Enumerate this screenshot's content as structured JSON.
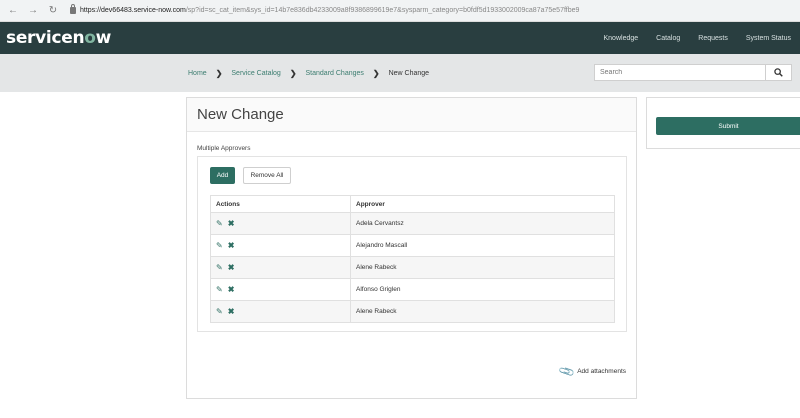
{
  "browser": {
    "url_host": "https://dev66483.service-now.com",
    "url_rest": "/sp?id=sc_cat_item&sys_id=14b7e836db4233009a8f9386899619e7&sysparm_category=b0fdf5d1933002009ca87a75e57ffbe9"
  },
  "header": {
    "logo_main": "servicen",
    "logo_o": "o",
    "logo_end": "w",
    "nav": [
      "Knowledge",
      "Catalog",
      "Requests",
      "System Status"
    ]
  },
  "breadcrumb": {
    "items": [
      "Home",
      "Service Catalog",
      "Standard Changes"
    ],
    "current": "New Change"
  },
  "search": {
    "placeholder": "Search"
  },
  "form": {
    "title": "New Change",
    "section_label": "Multiple Approvers",
    "add_label": "Add",
    "remove_all_label": "Remove All",
    "columns": [
      "Actions",
      "Approver"
    ],
    "rows": [
      {
        "approver": "Adela Cervantsz"
      },
      {
        "approver": "Alejandro Mascall"
      },
      {
        "approver": "Alene Rabeck"
      },
      {
        "approver": "Alfonso Griglen"
      },
      {
        "approver": "Alene Rabeck"
      }
    ],
    "attach_label": "Add attachments"
  },
  "side": {
    "submit_label": "Submit"
  },
  "colors": {
    "header_bg": "#293e40",
    "accent": "#2d6e62",
    "logo_accent": "#81b5a1"
  }
}
